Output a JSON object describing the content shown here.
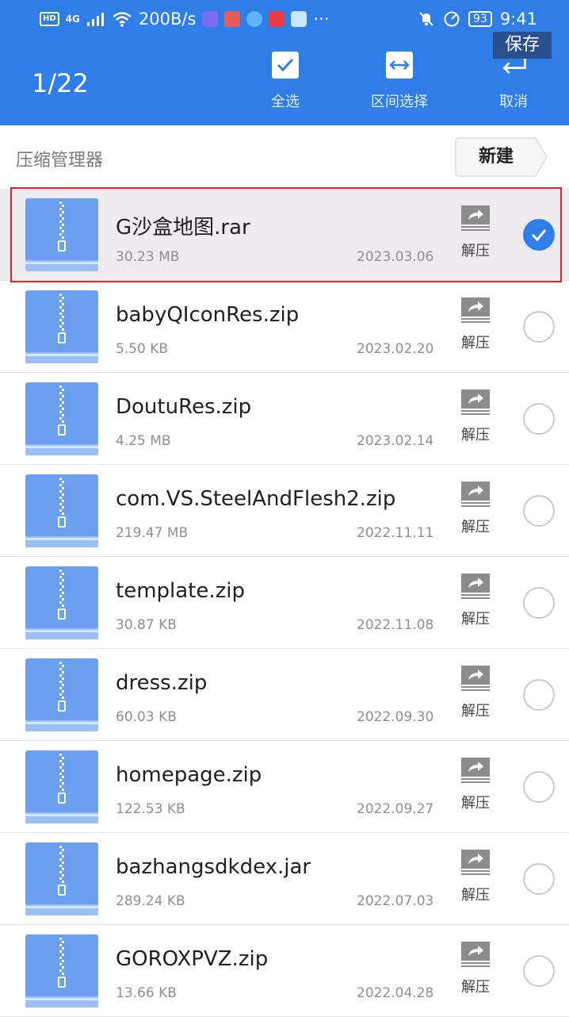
{
  "status_bar": {
    "hd": "HD",
    "net": "4G",
    "speed": "200B/s",
    "more": "···",
    "battery": "93",
    "time": "9:41"
  },
  "header": {
    "counter": "1/22",
    "select_all": "全选",
    "range_select": "区间选择",
    "cancel": "取消",
    "tooltip": "保存",
    "accent": "#2f7de6"
  },
  "path": {
    "label": "压缩管理器",
    "new_button": "新建"
  },
  "extract_label": "解压",
  "files": [
    {
      "name": "G沙盒地图.rar",
      "size": "30.23 MB",
      "date": "2023.03.06",
      "selected": true
    },
    {
      "name": "babyQIconRes.zip",
      "size": "5.50 KB",
      "date": "2023.02.20",
      "selected": false
    },
    {
      "name": "DoutuRes.zip",
      "size": "4.25 MB",
      "date": "2023.02.14",
      "selected": false
    },
    {
      "name": "com.VS.SteelAndFlesh2.zip",
      "size": "219.47 MB",
      "date": "2022.11.11",
      "selected": false
    },
    {
      "name": "template.zip",
      "size": "30.87 KB",
      "date": "2022.11.08",
      "selected": false
    },
    {
      "name": "dress.zip",
      "size": "60.03 KB",
      "date": "2022.09.30",
      "selected": false
    },
    {
      "name": "homepage.zip",
      "size": "122.53 KB",
      "date": "2022.09.27",
      "selected": false
    },
    {
      "name": "bazhangsdkdex.jar",
      "size": "289.24 KB",
      "date": "2022.07.03",
      "selected": false
    },
    {
      "name": "GOROXPVZ.zip",
      "size": "13.66 KB",
      "date": "2022.04.28",
      "selected": false
    }
  ]
}
